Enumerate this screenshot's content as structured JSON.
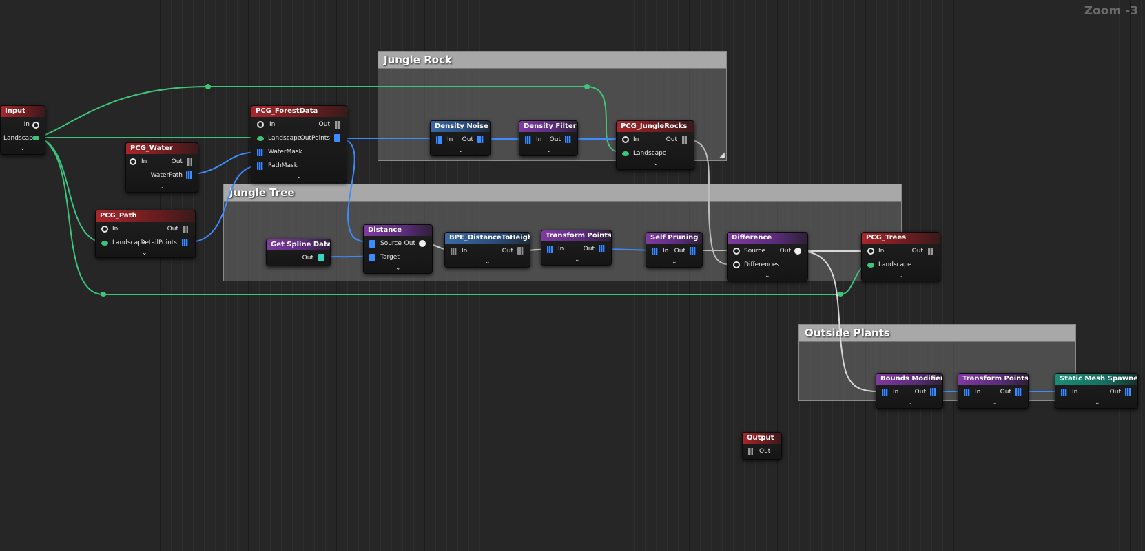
{
  "zoom_label": "Zoom -3",
  "comments": {
    "jungle_rock": "Jungle Rock",
    "jungle_tree": "Jungle Tree",
    "outside_plants": "Outside Plants"
  },
  "nodes": {
    "input": {
      "title": "Input",
      "pin_in": "In",
      "pin_landscape": "Landscape"
    },
    "pcg_water": {
      "title": "PCG_Water",
      "pin_in": "In",
      "pin_out": "Out",
      "pin_waterpath": "WaterPath"
    },
    "pcg_path": {
      "title": "PCG_Path",
      "pin_in": "In",
      "pin_out": "Out",
      "pin_landscape": "Landscape",
      "pin_detailpoints": "DetailPoints"
    },
    "pcg_forestdata": {
      "title": "PCG_ForestData",
      "pin_in": "In",
      "pin_out": "Out",
      "pin_landscape": "Landscape",
      "pin_outpoints": "OutPoints",
      "pin_watermask": "WaterMask",
      "pin_pathmask": "PathMask"
    },
    "density_noise": {
      "title": "Density Noise",
      "pin_in": "In",
      "pin_out": "Out"
    },
    "density_filter": {
      "title": "Density Filter",
      "pin_in": "In",
      "pin_out": "Out"
    },
    "pcg_junglerocks": {
      "title": "PCG_JungleRocks",
      "pin_in": "In",
      "pin_out": "Out",
      "pin_landscape": "Landscape"
    },
    "get_spline_data": {
      "title": "Get Spline Data",
      "pin_out": "Out"
    },
    "distance": {
      "title": "Distance",
      "pin_source": "Source",
      "pin_out": "Out",
      "pin_target": "Target"
    },
    "bpe_distance": {
      "title": "BPE_DistanceToHeight",
      "pin_in": "In",
      "pin_out": "Out"
    },
    "transform_points": {
      "title": "Transform Points",
      "pin_in": "In",
      "pin_out": "Out"
    },
    "self_pruning": {
      "title": "Self Pruning",
      "pin_in": "In",
      "pin_out": "Out"
    },
    "difference": {
      "title": "Difference",
      "pin_source": "Source",
      "pin_out": "Out",
      "pin_differences": "Differences"
    },
    "pcg_trees": {
      "title": "PCG_Trees",
      "pin_in": "In",
      "pin_out": "Out",
      "pin_landscape": "Landscape"
    },
    "bounds_modifier": {
      "title": "Bounds Modifier",
      "pin_in": "In",
      "pin_out": "Out"
    },
    "transform_points_2": {
      "title": "Transform Points",
      "pin_in": "In",
      "pin_out": "Out"
    },
    "static_mesh_spawner": {
      "title": "Static Mesh Spawner",
      "pin_in": "In",
      "pin_out": "Out"
    },
    "output": {
      "title": "Output",
      "pin_out": "Out"
    }
  },
  "colors": {
    "background": "#262626",
    "wire_landscape": "#3fc47c",
    "wire_points": "#3d8cff",
    "wire_any": "#d8d8d8",
    "header_input_output": "#a9262b",
    "header_subgraph": "#7e3aa0",
    "header_sampler": "#3a6aa5",
    "header_spawner": "#1a8c78"
  },
  "icons": {
    "point_pin": "point-data-pin-icon",
    "spline_pin": "spline-data-pin-icon",
    "landscape_pin": "landscape-data-pin-icon",
    "any_pin": "any-data-pin-icon",
    "expand": "chevron-down-icon",
    "resize": "resize-grip-icon"
  }
}
